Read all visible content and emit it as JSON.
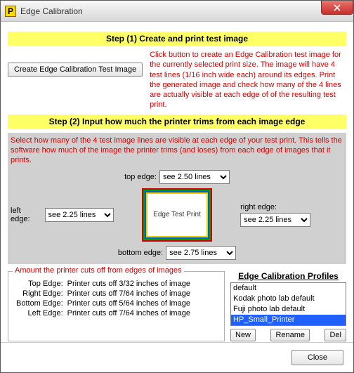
{
  "window": {
    "title": "Edge Calibration",
    "app_icon_letter": "P",
    "close_label": "Close"
  },
  "step1": {
    "header": "Step (1) Create and print test image",
    "button": "Create Edge Calibration Test Image",
    "instructions": "Click button to create an Edge Calibration test image for the currently selected print size.  The image will have 4 test lines (1/16 inch wide each) around its edges.  Print the generated image and check how many of the 4 lines are actually visible at each edge of of the resulting test print."
  },
  "step2": {
    "header": "Step (2) Input how much the printer trims from each image edge",
    "instructions": "Select how many of the 4 test image lines are visible at each edge of your test print.  This tells the software how much of the image the printer trims (and loses) from each edge of images that it prints.",
    "test_print_label": "Edge Test Print",
    "edges": {
      "top": {
        "label": "top edge:",
        "value": "see 2.50 lines"
      },
      "left": {
        "label": "left edge:",
        "value": "see 2.25 lines"
      },
      "right": {
        "label": "right edge:",
        "value": "see 2.25 lines"
      },
      "bottom": {
        "label": "bottom edge:",
        "value": "see 2.75 lines"
      }
    }
  },
  "cuts": {
    "legend": "Amount the printer cuts off from edges of images",
    "rows": [
      {
        "edge": "Top Edge:",
        "text": "Printer cuts off  3/32 inches of image"
      },
      {
        "edge": "Right Edge:",
        "text": "Printer cuts off  7/64 inches of image"
      },
      {
        "edge": "Bottom Edge:",
        "text": "Printer cuts off  5/64 inches of image"
      },
      {
        "edge": "Left Edge:",
        "text": "Printer cuts off  7/64 inches of image"
      }
    ]
  },
  "profiles": {
    "title": "Edge Calibration Profiles",
    "items": [
      "default",
      "Kodak photo lab default",
      "Fuji photo lab default",
      "HP_Small_Printer"
    ],
    "selected_index": 3,
    "buttons": {
      "new": "New",
      "rename": "Rename",
      "del": "Del"
    }
  },
  "footer": {
    "close": "Close"
  }
}
